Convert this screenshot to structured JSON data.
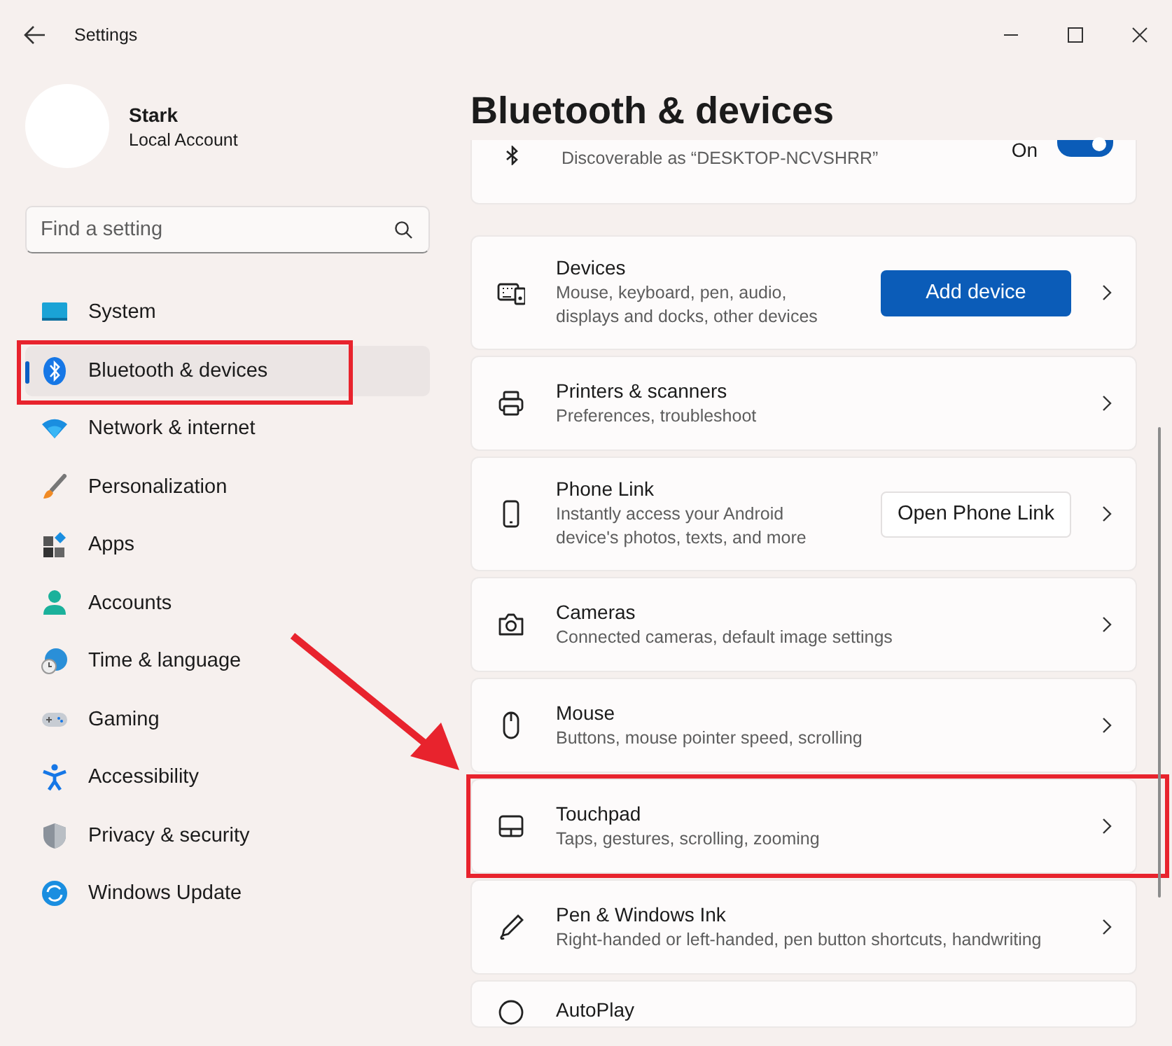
{
  "window": {
    "title": "Settings"
  },
  "profile": {
    "name": "Stark",
    "account_type": "Local Account"
  },
  "search": {
    "placeholder": "Find a setting"
  },
  "nav": [
    {
      "kind": "system",
      "label": "System",
      "selected": false,
      "highlighted": false
    },
    {
      "kind": "bluetooth",
      "label": "Bluetooth & devices",
      "selected": true,
      "highlighted": true
    },
    {
      "kind": "network",
      "label": "Network & internet",
      "selected": false,
      "highlighted": false
    },
    {
      "kind": "personalization",
      "label": "Personalization",
      "selected": false,
      "highlighted": false
    },
    {
      "kind": "apps",
      "label": "Apps",
      "selected": false,
      "highlighted": false
    },
    {
      "kind": "accounts",
      "label": "Accounts",
      "selected": false,
      "highlighted": false
    },
    {
      "kind": "time",
      "label": "Time & language",
      "selected": false,
      "highlighted": false
    },
    {
      "kind": "gaming",
      "label": "Gaming",
      "selected": false,
      "highlighted": false
    },
    {
      "kind": "accessibility",
      "label": "Accessibility",
      "selected": false,
      "highlighted": false
    },
    {
      "kind": "privacy",
      "label": "Privacy & security",
      "selected": false,
      "highlighted": false
    },
    {
      "kind": "update",
      "label": "Windows Update",
      "selected": false,
      "highlighted": false
    }
  ],
  "page_title": "Bluetooth & devices",
  "bluetooth": {
    "state_label": "On",
    "on": true,
    "subtitle": "Discoverable as “DESKTOP-NCVSHRR”"
  },
  "cards": [
    {
      "kind": "devices",
      "title": "Devices",
      "subtitle": "Mouse, keyboard, pen, audio, displays and docks, other devices",
      "action": {
        "kind": "primary",
        "label": "Add device"
      },
      "highlighted": false
    },
    {
      "kind": "printer",
      "title": "Printers & scanners",
      "subtitle": "Preferences, troubleshoot",
      "highlighted": false
    },
    {
      "kind": "phone",
      "title": "Phone Link",
      "subtitle": "Instantly access your Android device's photos, texts, and more",
      "action": {
        "kind": "secondary",
        "label": "Open Phone Link"
      },
      "highlighted": false
    },
    {
      "kind": "camera",
      "title": "Cameras",
      "subtitle": "Connected cameras, default image settings",
      "highlighted": false
    },
    {
      "kind": "mouse",
      "title": "Mouse",
      "subtitle": "Buttons, mouse pointer speed, scrolling",
      "highlighted": false
    },
    {
      "kind": "touchpad",
      "title": "Touchpad",
      "subtitle": "Taps, gestures, scrolling, zooming",
      "highlighted": true
    },
    {
      "kind": "pen",
      "title": "Pen & Windows Ink",
      "subtitle": "Right-handed or left-handed, pen button shortcuts, handwriting",
      "highlighted": false
    },
    {
      "kind": "autoplay",
      "title": "AutoPlay",
      "highlighted": false
    }
  ]
}
